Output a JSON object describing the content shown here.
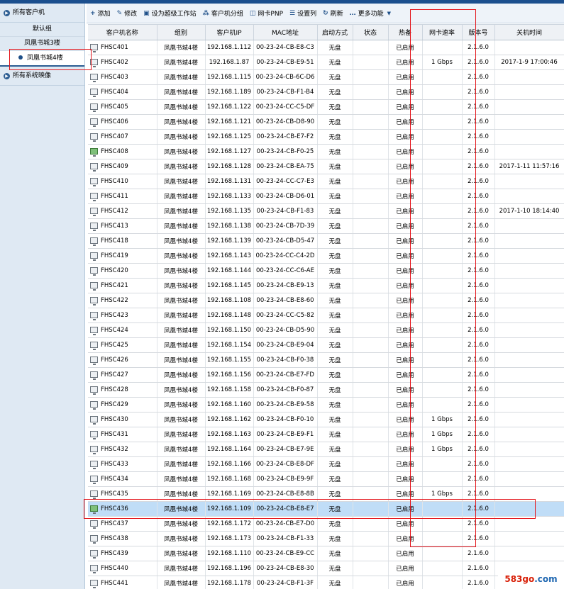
{
  "sidebar": {
    "all_clients": "所有客户机",
    "groups": [
      {
        "label": "默认组"
      },
      {
        "label": "凤凰书城3楼"
      },
      {
        "label": "凤凰书城4楼"
      }
    ],
    "all_images": "所有系统映像"
  },
  "toolbar": {
    "add": "添加",
    "edit": "修改",
    "set_super": "设为超级工作站",
    "client_group": "客户机分组",
    "nic_pnp": "网卡PNP",
    "set_columns": "设置列",
    "refresh": "刷新",
    "more": "更多功能"
  },
  "table": {
    "headers": [
      "客户机名称",
      "组别",
      "客户机IP",
      "MAC地址",
      "启动方式",
      "状态",
      "热备",
      "网卡速率",
      "版本号",
      "关机时间"
    ],
    "rows": [
      {
        "name": "FHSC401",
        "group": "凤凰书城4楼",
        "ip": "192.168.1.112",
        "mac": "00-23-24-CB-E8-C3",
        "boot": "无盘",
        "status": "",
        "hot": "已启用",
        "nic": "",
        "ver": "2.1.6.0",
        "time": "",
        "online": false
      },
      {
        "name": "FHSC402",
        "group": "凤凰书城4楼",
        "ip": "192.168.1.87",
        "mac": "00-23-24-CB-E9-51",
        "boot": "无盘",
        "status": "",
        "hot": "已启用",
        "nic": "1 Gbps",
        "ver": "2.1.6.0",
        "time": "2017-1-9 17:00:46",
        "online": false
      },
      {
        "name": "FHSC403",
        "group": "凤凰书城4楼",
        "ip": "192.168.1.115",
        "mac": "00-23-24-CB-6C-D6",
        "boot": "无盘",
        "status": "",
        "hot": "已启用",
        "nic": "",
        "ver": "2.1.6.0",
        "time": "",
        "online": false
      },
      {
        "name": "FHSC404",
        "group": "凤凰书城4楼",
        "ip": "192.168.1.189",
        "mac": "00-23-24-CB-F1-B4",
        "boot": "无盘",
        "status": "",
        "hot": "已启用",
        "nic": "",
        "ver": "2.1.6.0",
        "time": "",
        "online": false
      },
      {
        "name": "FHSC405",
        "group": "凤凰书城4楼",
        "ip": "192.168.1.122",
        "mac": "00-23-24-CC-C5-DF",
        "boot": "无盘",
        "status": "",
        "hot": "已启用",
        "nic": "",
        "ver": "2.1.6.0",
        "time": "",
        "online": false
      },
      {
        "name": "FHSC406",
        "group": "凤凰书城4楼",
        "ip": "192.168.1.121",
        "mac": "00-23-24-CB-D8-90",
        "boot": "无盘",
        "status": "",
        "hot": "已启用",
        "nic": "",
        "ver": "2.1.6.0",
        "time": "",
        "online": false
      },
      {
        "name": "FHSC407",
        "group": "凤凰书城4楼",
        "ip": "192.168.1.125",
        "mac": "00-23-24-CB-E7-F2",
        "boot": "无盘",
        "status": "",
        "hot": "已启用",
        "nic": "",
        "ver": "2.1.6.0",
        "time": "",
        "online": false
      },
      {
        "name": "FHSC408",
        "group": "凤凰书城4楼",
        "ip": "192.168.1.127",
        "mac": "00-23-24-CB-F0-25",
        "boot": "无盘",
        "status": "",
        "hot": "已启用",
        "nic": "",
        "ver": "2.1.6.0",
        "time": "",
        "online": true
      },
      {
        "name": "FHSC409",
        "group": "凤凰书城4楼",
        "ip": "192.168.1.128",
        "mac": "00-23-24-CB-EA-75",
        "boot": "无盘",
        "status": "",
        "hot": "已启用",
        "nic": "",
        "ver": "2.1.6.0",
        "time": "2017-1-11 11:57:16",
        "online": false
      },
      {
        "name": "FHSC410",
        "group": "凤凰书城4楼",
        "ip": "192.168.1.131",
        "mac": "00-23-24-CC-C7-E3",
        "boot": "无盘",
        "status": "",
        "hot": "已启用",
        "nic": "",
        "ver": "2.1.6.0",
        "time": "",
        "online": false
      },
      {
        "name": "FHSC411",
        "group": "凤凰书城4楼",
        "ip": "192.168.1.133",
        "mac": "00-23-24-CB-D6-01",
        "boot": "无盘",
        "status": "",
        "hot": "已启用",
        "nic": "",
        "ver": "2.1.6.0",
        "time": "",
        "online": false
      },
      {
        "name": "FHSC412",
        "group": "凤凰书城4楼",
        "ip": "192.168.1.135",
        "mac": "00-23-24-CB-F1-83",
        "boot": "无盘",
        "status": "",
        "hot": "已启用",
        "nic": "",
        "ver": "2.1.6.0",
        "time": "2017-1-10 18:14:40",
        "online": false
      },
      {
        "name": "FHSC413",
        "group": "凤凰书城4楼",
        "ip": "192.168.1.138",
        "mac": "00-23-24-CB-7D-39",
        "boot": "无盘",
        "status": "",
        "hot": "已启用",
        "nic": "",
        "ver": "2.1.6.0",
        "time": "",
        "online": false
      },
      {
        "name": "FHSC418",
        "group": "凤凰书城4楼",
        "ip": "192.168.1.139",
        "mac": "00-23-24-CB-D5-47",
        "boot": "无盘",
        "status": "",
        "hot": "已启用",
        "nic": "",
        "ver": "2.1.6.0",
        "time": "",
        "online": false
      },
      {
        "name": "FHSC419",
        "group": "凤凰书城4楼",
        "ip": "192.168.1.143",
        "mac": "00-23-24-CC-C4-2D",
        "boot": "无盘",
        "status": "",
        "hot": "已启用",
        "nic": "",
        "ver": "2.1.6.0",
        "time": "",
        "online": false
      },
      {
        "name": "FHSC420",
        "group": "凤凰书城4楼",
        "ip": "192.168.1.144",
        "mac": "00-23-24-CC-C6-AE",
        "boot": "无盘",
        "status": "",
        "hot": "已启用",
        "nic": "",
        "ver": "2.1.6.0",
        "time": "",
        "online": false
      },
      {
        "name": "FHSC421",
        "group": "凤凰书城4楼",
        "ip": "192.168.1.145",
        "mac": "00-23-24-CB-E9-13",
        "boot": "无盘",
        "status": "",
        "hot": "已启用",
        "nic": "",
        "ver": "2.1.6.0",
        "time": "",
        "online": false
      },
      {
        "name": "FHSC422",
        "group": "凤凰书城4楼",
        "ip": "192.168.1.108",
        "mac": "00-23-24-CB-E8-60",
        "boot": "无盘",
        "status": "",
        "hot": "已启用",
        "nic": "",
        "ver": "2.1.6.0",
        "time": "",
        "online": false
      },
      {
        "name": "FHSC423",
        "group": "凤凰书城4楼",
        "ip": "192.168.1.148",
        "mac": "00-23-24-CC-C5-82",
        "boot": "无盘",
        "status": "",
        "hot": "已启用",
        "nic": "",
        "ver": "2.1.6.0",
        "time": "",
        "online": false
      },
      {
        "name": "FHSC424",
        "group": "凤凰书城4楼",
        "ip": "192.168.1.150",
        "mac": "00-23-24-CB-D5-90",
        "boot": "无盘",
        "status": "",
        "hot": "已启用",
        "nic": "",
        "ver": "2.1.6.0",
        "time": "",
        "online": false
      },
      {
        "name": "FHSC425",
        "group": "凤凰书城4楼",
        "ip": "192.168.1.154",
        "mac": "00-23-24-CB-E9-04",
        "boot": "无盘",
        "status": "",
        "hot": "已启用",
        "nic": "",
        "ver": "2.1.6.0",
        "time": "",
        "online": false
      },
      {
        "name": "FHSC426",
        "group": "凤凰书城4楼",
        "ip": "192.168.1.155",
        "mac": "00-23-24-CB-F0-38",
        "boot": "无盘",
        "status": "",
        "hot": "已启用",
        "nic": "",
        "ver": "2.1.6.0",
        "time": "",
        "online": false
      },
      {
        "name": "FHSC427",
        "group": "凤凰书城4楼",
        "ip": "192.168.1.156",
        "mac": "00-23-24-CB-E7-FD",
        "boot": "无盘",
        "status": "",
        "hot": "已启用",
        "nic": "",
        "ver": "2.1.6.0",
        "time": "",
        "online": false
      },
      {
        "name": "FHSC428",
        "group": "凤凰书城4楼",
        "ip": "192.168.1.158",
        "mac": "00-23-24-CB-F0-87",
        "boot": "无盘",
        "status": "",
        "hot": "已启用",
        "nic": "",
        "ver": "2.1.6.0",
        "time": "",
        "online": false
      },
      {
        "name": "FHSC429",
        "group": "凤凰书城4楼",
        "ip": "192.168.1.160",
        "mac": "00-23-24-CB-E9-58",
        "boot": "无盘",
        "status": "",
        "hot": "已启用",
        "nic": "",
        "ver": "2.1.6.0",
        "time": "",
        "online": false
      },
      {
        "name": "FHSC430",
        "group": "凤凰书城4楼",
        "ip": "192.168.1.162",
        "mac": "00-23-24-CB-F0-10",
        "boot": "无盘",
        "status": "",
        "hot": "已启用",
        "nic": "1 Gbps",
        "ver": "2.1.6.0",
        "time": "",
        "online": false
      },
      {
        "name": "FHSC431",
        "group": "凤凰书城4楼",
        "ip": "192.168.1.163",
        "mac": "00-23-24-CB-E9-F1",
        "boot": "无盘",
        "status": "",
        "hot": "已启用",
        "nic": "1 Gbps",
        "ver": "2.1.6.0",
        "time": "",
        "online": false
      },
      {
        "name": "FHSC432",
        "group": "凤凰书城4楼",
        "ip": "192.168.1.164",
        "mac": "00-23-24-CB-E7-9E",
        "boot": "无盘",
        "status": "",
        "hot": "已启用",
        "nic": "1 Gbps",
        "ver": "2.1.6.0",
        "time": "",
        "online": false
      },
      {
        "name": "FHSC433",
        "group": "凤凰书城4楼",
        "ip": "192.168.1.166",
        "mac": "00-23-24-CB-E8-DF",
        "boot": "无盘",
        "status": "",
        "hot": "已启用",
        "nic": "",
        "ver": "2.1.6.0",
        "time": "",
        "online": false
      },
      {
        "name": "FHSC434",
        "group": "凤凰书城4楼",
        "ip": "192.168.1.168",
        "mac": "00-23-24-CB-E9-9F",
        "boot": "无盘",
        "status": "",
        "hot": "已启用",
        "nic": "",
        "ver": "2.1.6.0",
        "time": "",
        "online": false
      },
      {
        "name": "FHSC435",
        "group": "凤凰书城4楼",
        "ip": "192.168.1.169",
        "mac": "00-23-24-CB-E8-8B",
        "boot": "无盘",
        "status": "",
        "hot": "已启用",
        "nic": "1 Gbps",
        "ver": "2.1.6.0",
        "time": "",
        "online": false
      },
      {
        "name": "FHSC436",
        "group": "凤凰书城4楼",
        "ip": "192.168.1.109",
        "mac": "00-23-24-CB-E8-E7",
        "boot": "无盘",
        "status": "",
        "hot": "已启用",
        "nic": "",
        "ver": "2.1.6.0",
        "time": "",
        "online": true,
        "selected": true
      },
      {
        "name": "FHSC437",
        "group": "凤凰书城4楼",
        "ip": "192.168.1.172",
        "mac": "00-23-24-CB-E7-D0",
        "boot": "无盘",
        "status": "",
        "hot": "已启用",
        "nic": "",
        "ver": "2.1.6.0",
        "time": "",
        "online": false
      },
      {
        "name": "FHSC438",
        "group": "凤凰书城4楼",
        "ip": "192.168.1.173",
        "mac": "00-23-24-CB-F1-33",
        "boot": "无盘",
        "status": "",
        "hot": "已启用",
        "nic": "",
        "ver": "2.1.6.0",
        "time": "",
        "online": false
      },
      {
        "name": "FHSC439",
        "group": "凤凰书城4楼",
        "ip": "192.168.1.110",
        "mac": "00-23-24-CB-E9-CC",
        "boot": "无盘",
        "status": "",
        "hot": "已启用",
        "nic": "",
        "ver": "2.1.6.0",
        "time": "",
        "online": false
      },
      {
        "name": "FHSC440",
        "group": "凤凰书城4楼",
        "ip": "192.168.1.196",
        "mac": "00-23-24-CB-E8-30",
        "boot": "无盘",
        "status": "",
        "hot": "已启用",
        "nic": "",
        "ver": "2.1.6.0",
        "time": "",
        "online": false
      },
      {
        "name": "FHSC441",
        "group": "凤凰书城4楼",
        "ip": "192.168.1.178",
        "mac": "00-23-24-CB-F1-3F",
        "boot": "无盘",
        "status": "",
        "hot": "已启用",
        "nic": "",
        "ver": "2.1.6.0",
        "time": "",
        "online": false
      }
    ]
  },
  "watermark": {
    "part_a": "583go",
    "part_b": ".com"
  },
  "colors": {
    "accent": "#1e4f88",
    "selected_row": "#c0ddf7",
    "annotation": "#e4151b",
    "online_icon": "#7fc07a"
  }
}
